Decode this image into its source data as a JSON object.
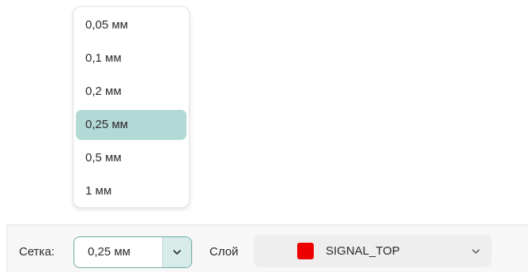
{
  "grid_dropdown": {
    "options": [
      "0,05 мм",
      "0,1 мм",
      "0,2 мм",
      "0,25 мм",
      "0,5 мм",
      "1 мм"
    ],
    "selected_index": 3
  },
  "toolbar": {
    "grid_label": "Сетка:",
    "grid_value": "0,25 мм",
    "layer_label": "Слой",
    "layer_value": "SIGNAL_TOP",
    "layer_color": "#ee0000",
    "accent_color": "#6ba9a6",
    "selected_color": "#b3d9d6"
  },
  "icons": {
    "grid_toggle": "chevron-down-icon",
    "layer_toggle": "chevron-down-icon"
  }
}
